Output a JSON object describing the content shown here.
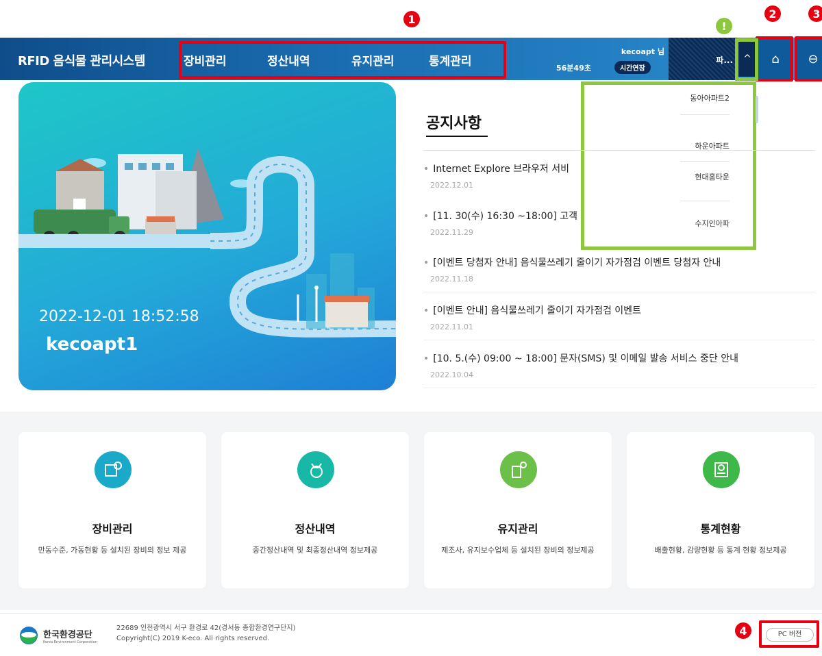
{
  "markers": {
    "m1": "1",
    "m2": "2",
    "m3": "3",
    "m4": "4",
    "alert": "!"
  },
  "header": {
    "brand": "RFID 음식물 관리시스템",
    "nav": [
      "장비관리",
      "정산내역",
      "유지관리",
      "통계관리"
    ],
    "user": "kecoapt 님",
    "timer": "56분49초",
    "extend_label": "시간연장",
    "apartment_value": "파...",
    "toggle_glyph": "^",
    "home_glyph": "⌂",
    "logout_glyph": "⊖"
  },
  "dropdown": {
    "items": [
      "동아아파트2",
      "하운아파트",
      "현대홈타운",
      "수지인아파"
    ]
  },
  "hero": {
    "datetime": "2022-12-01 18:52:58",
    "username": "kecoapt1"
  },
  "notices": {
    "title": "공지사항",
    "items": [
      {
        "text": "Internet Explore 브라우저 서비",
        "date": "2022.12.01"
      },
      {
        "text": "[11. 30(수) 16:30 ~18:00] 고객",
        "date": "2022.11.29"
      },
      {
        "text": "[이벤트 당첨자 안내] 음식물쓰레기 줄이기 자가점검 이벤트 당첨자 안내",
        "date": "2022.11.18"
      },
      {
        "text": "[이벤트 안내] 음식물쓰레기 줄이기 자가점검 이벤트",
        "date": "2022.11.01"
      },
      {
        "text": "[10. 5.(수) 09:00 ~ 18:00] 문자(SMS) 및 이메일 발송 서비스 중단 안내",
        "date": "2022.10.04"
      }
    ]
  },
  "cards": [
    {
      "title": "장비관리",
      "desc": "만동수준, 가동현황 등 설치된 장비의 정보 제공",
      "color": "#1aa9c9"
    },
    {
      "title": "정산내역",
      "desc": "중간정산내역 및 최종정산내역 정보제공",
      "color": "#17b9a6"
    },
    {
      "title": "유지관리",
      "desc": "제조사, 유지보수업체 등 설치된 장비의 정보제공",
      "color": "#6cc04a"
    },
    {
      "title": "통계현황",
      "desc": "배출현황, 감량현황 등 통계 현황 정보제공",
      "color": "#3fb84a"
    }
  ],
  "footer": {
    "org": "한국환경공단",
    "org_en": "Korea Environment Corporation",
    "address": "22689 인천광역시 서구 환경로 42(경서동 종합환경연구단지)",
    "copyright": "Copyright(C) 2019 K-eco. All rights reserved.",
    "pc_button": "PC 버전"
  }
}
